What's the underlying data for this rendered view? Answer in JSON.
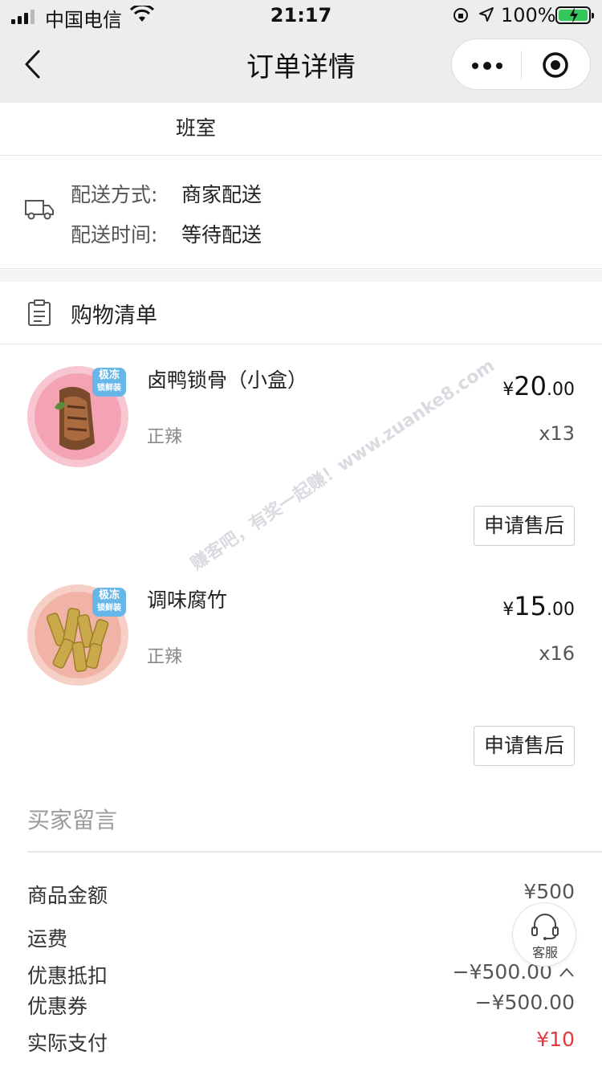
{
  "status_bar": {
    "carrier": "中国电信",
    "time": "21:17",
    "battery_percent": "100%"
  },
  "nav": {
    "title": "订单详情"
  },
  "address": {
    "tail_text": "班室"
  },
  "delivery": {
    "method_label": "配送方式:",
    "method_value": "商家配送",
    "time_label": "配送时间:",
    "time_value": "等待配送"
  },
  "shopping_list": {
    "title": "购物清单",
    "items": [
      {
        "name": "卤鸭锁骨（小盒）",
        "spec": "正辣",
        "currency": "¥",
        "price_int": "20",
        "price_dec": ".00",
        "qty": "x13",
        "badge_line1": "极冻",
        "badge_line2": "锁鲜装",
        "after_sale_label": "申请售后"
      },
      {
        "name": "调味腐竹",
        "spec": "正辣",
        "currency": "¥",
        "price_int": "15",
        "price_dec": ".00",
        "qty": "x16",
        "badge_line1": "极冻",
        "badge_line2": "锁鲜装",
        "after_sale_label": "申请售后"
      }
    ]
  },
  "watermark": "赚客吧，有奖一起赚！www.zuanke8.com",
  "buyer_message": {
    "label": "买家留言"
  },
  "summary": {
    "goods_amount_label": "商品金额",
    "goods_amount_value": "¥500",
    "shipping_label": "运费",
    "discount_label": "优惠抵扣",
    "discount_value": "−¥500.00",
    "coupon_label": "优惠券",
    "coupon_value": "−¥500.00",
    "actual_pay_label": "实际支付",
    "actual_pay_value": "¥10"
  },
  "customer_service": {
    "label": "客服"
  },
  "colors": {
    "nav_bg": "#ededed",
    "accent_red": "#e4393c",
    "battery_green": "#34c759",
    "badge_blue": "#66b6e8"
  }
}
